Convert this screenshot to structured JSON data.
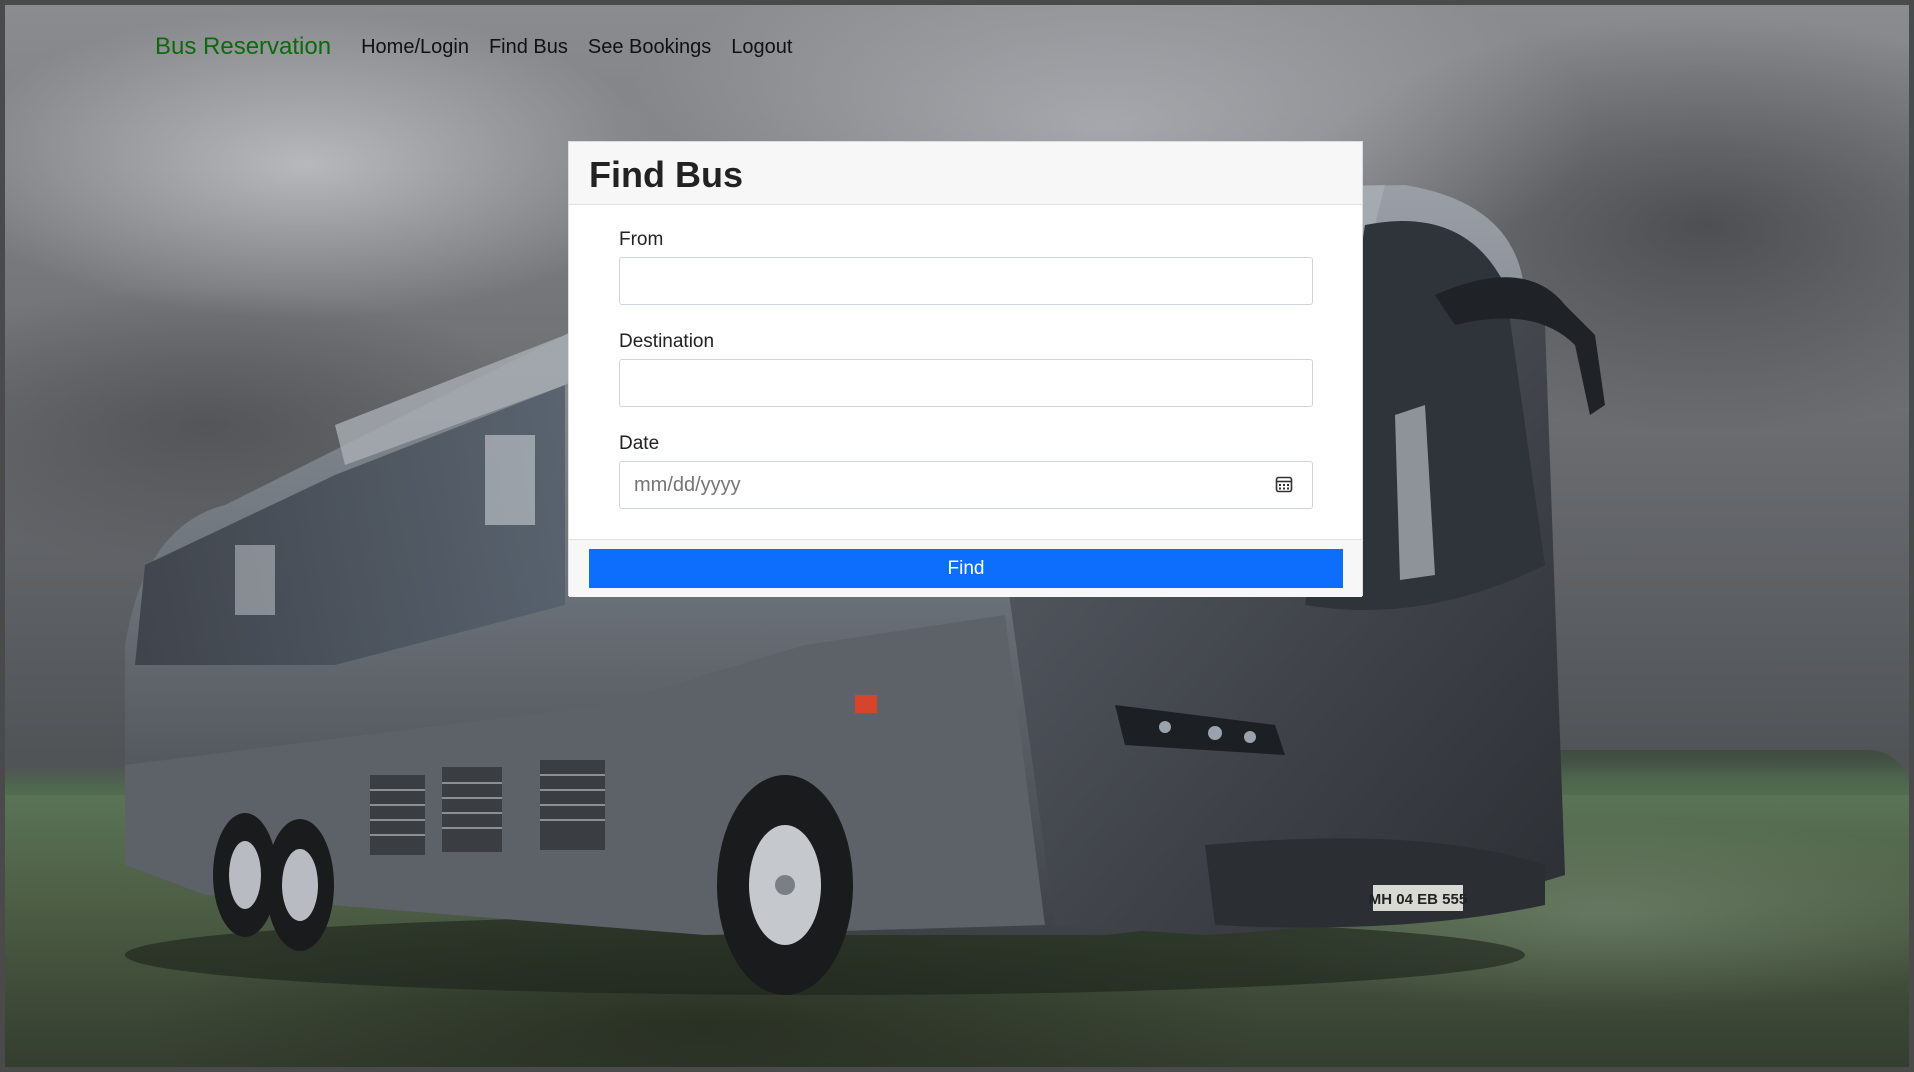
{
  "navbar": {
    "brand": "Bus Reservation",
    "links": [
      "Home/Login",
      "Find Bus",
      "See Bookings",
      "Logout"
    ]
  },
  "card": {
    "title": "Find Bus",
    "fields": {
      "from_label": "From",
      "destination_label": "Destination",
      "date_label": "Date",
      "date_placeholder": "mm/dd/yyyy"
    },
    "button_label": "Find"
  },
  "icons": {
    "date_picker": "calendar-icon"
  },
  "colors": {
    "brand": "#0a6b0a",
    "primary_button": "#0d6efd"
  },
  "background": {
    "license_plate": "MH 04 EB 555"
  }
}
